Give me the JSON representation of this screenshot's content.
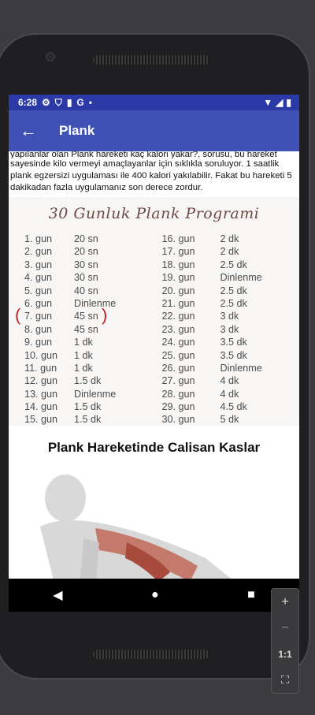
{
  "status_bar": {
    "time": "6:28",
    "dot": "•"
  },
  "app_bar": {
    "title": "Plank"
  },
  "intro": {
    "cut_line": "yapılanlar olan Plank hareketi kaç kalori yakar?, sorusu, bu hareket",
    "text": "sayesinde kilo vermeyi amaçlayanlar için sıklıkla soruluyor. 1 saatlik plank egzersizi uygulaması ile 400 kalori yakılabilir. Fakat bu hareketi 5 dakikadan fazla uygulamanız son derece zordur."
  },
  "program": {
    "title": "30 Gunluk Plank Programi",
    "left": [
      [
        "1. gun",
        "20 sn"
      ],
      [
        "2. gun",
        "20 sn"
      ],
      [
        "3. gun",
        "30 sn"
      ],
      [
        "4. gun",
        "30 sn"
      ],
      [
        "5. gun",
        "40 sn"
      ],
      [
        "6. gun",
        "Dinlenme"
      ],
      [
        "7. gun",
        "45 sn"
      ],
      [
        "8. gun",
        "45 sn"
      ],
      [
        "9. gun",
        "1 dk"
      ],
      [
        "10. gun",
        "1 dk"
      ],
      [
        "11. gun",
        "1 dk"
      ],
      [
        "12. gun",
        "1.5 dk"
      ],
      [
        "13. gun",
        "Dinlenme"
      ],
      [
        "14. gun",
        "1.5 dk"
      ],
      [
        "15. gun",
        "1.5 dk"
      ]
    ],
    "right": [
      [
        "16. gun",
        "2 dk"
      ],
      [
        "17. gun",
        "2 dk"
      ],
      [
        "18. gun",
        "2.5 dk"
      ],
      [
        "19. gun",
        "Dinlenme"
      ],
      [
        "20. gun",
        "2.5 dk"
      ],
      [
        "21. gun",
        "2.5 dk"
      ],
      [
        "22. gun",
        "3 dk"
      ],
      [
        "23. gun",
        "3 dk"
      ],
      [
        "24. gun",
        "3.5 dk"
      ],
      [
        "25. gun",
        "3.5 dk"
      ],
      [
        "26. gun",
        "Dinlenme"
      ],
      [
        "27. gun",
        "4 dk"
      ],
      [
        "28. gun",
        "4 dk"
      ],
      [
        "29. gun",
        "4.5 dk"
      ],
      [
        "30. gun",
        "5 dk"
      ]
    ],
    "marker_left": "(",
    "marker_right": ")"
  },
  "section": {
    "title": "Plank Hareketinde Calisan Kaslar"
  },
  "zoom_controls": {
    "plus": "+",
    "minus": "−",
    "ratio": "1:1"
  },
  "colors": {
    "status": "#2c3aa8",
    "appbar": "#3f51b5",
    "program_title": "#6d4a45",
    "marker": "#c41e1e"
  }
}
